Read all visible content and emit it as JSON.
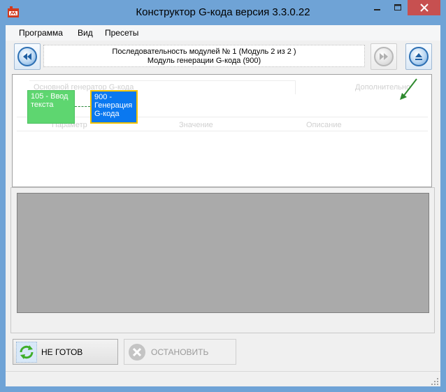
{
  "window": {
    "title": "Конструктор G-кода версия 3.3.0.22"
  },
  "menu": {
    "items": [
      "Программа",
      "Вид",
      "Пресеты"
    ]
  },
  "toolbar": {
    "sequence_line1": "Последовательность модулей № 1 (Модуль 2 из 2 )",
    "sequence_line2": "Модуль генерации G-кода (900)"
  },
  "diagram": {
    "modules": [
      {
        "label": "105 - Ввод текста",
        "color": "#5ed670"
      },
      {
        "label": "900 - Генерация G-кода",
        "color": "#0a78f0",
        "selected": true
      }
    ]
  },
  "background_faded": {
    "combo": "Основной генератор G-кода",
    "extra_button": "Дополнительно",
    "col_param": "Параметр",
    "col_value": "Значение",
    "col_desc": "Описание"
  },
  "actions": {
    "ready_label": "НЕ ГОТОВ",
    "stop_label": "ОСТАНОВИТЬ"
  },
  "colors": {
    "frame": "#6fa3d6",
    "close": "#c75050",
    "canvas": "#aaaaaa",
    "selected_border": "#f3c200"
  },
  "icons": [
    "app-icon",
    "minimize-icon",
    "maximize-icon",
    "close-icon",
    "rewind-icon",
    "fast-forward-icon",
    "eject-icon",
    "refresh-icon",
    "stop-icon",
    "resize-grip-icon"
  ]
}
